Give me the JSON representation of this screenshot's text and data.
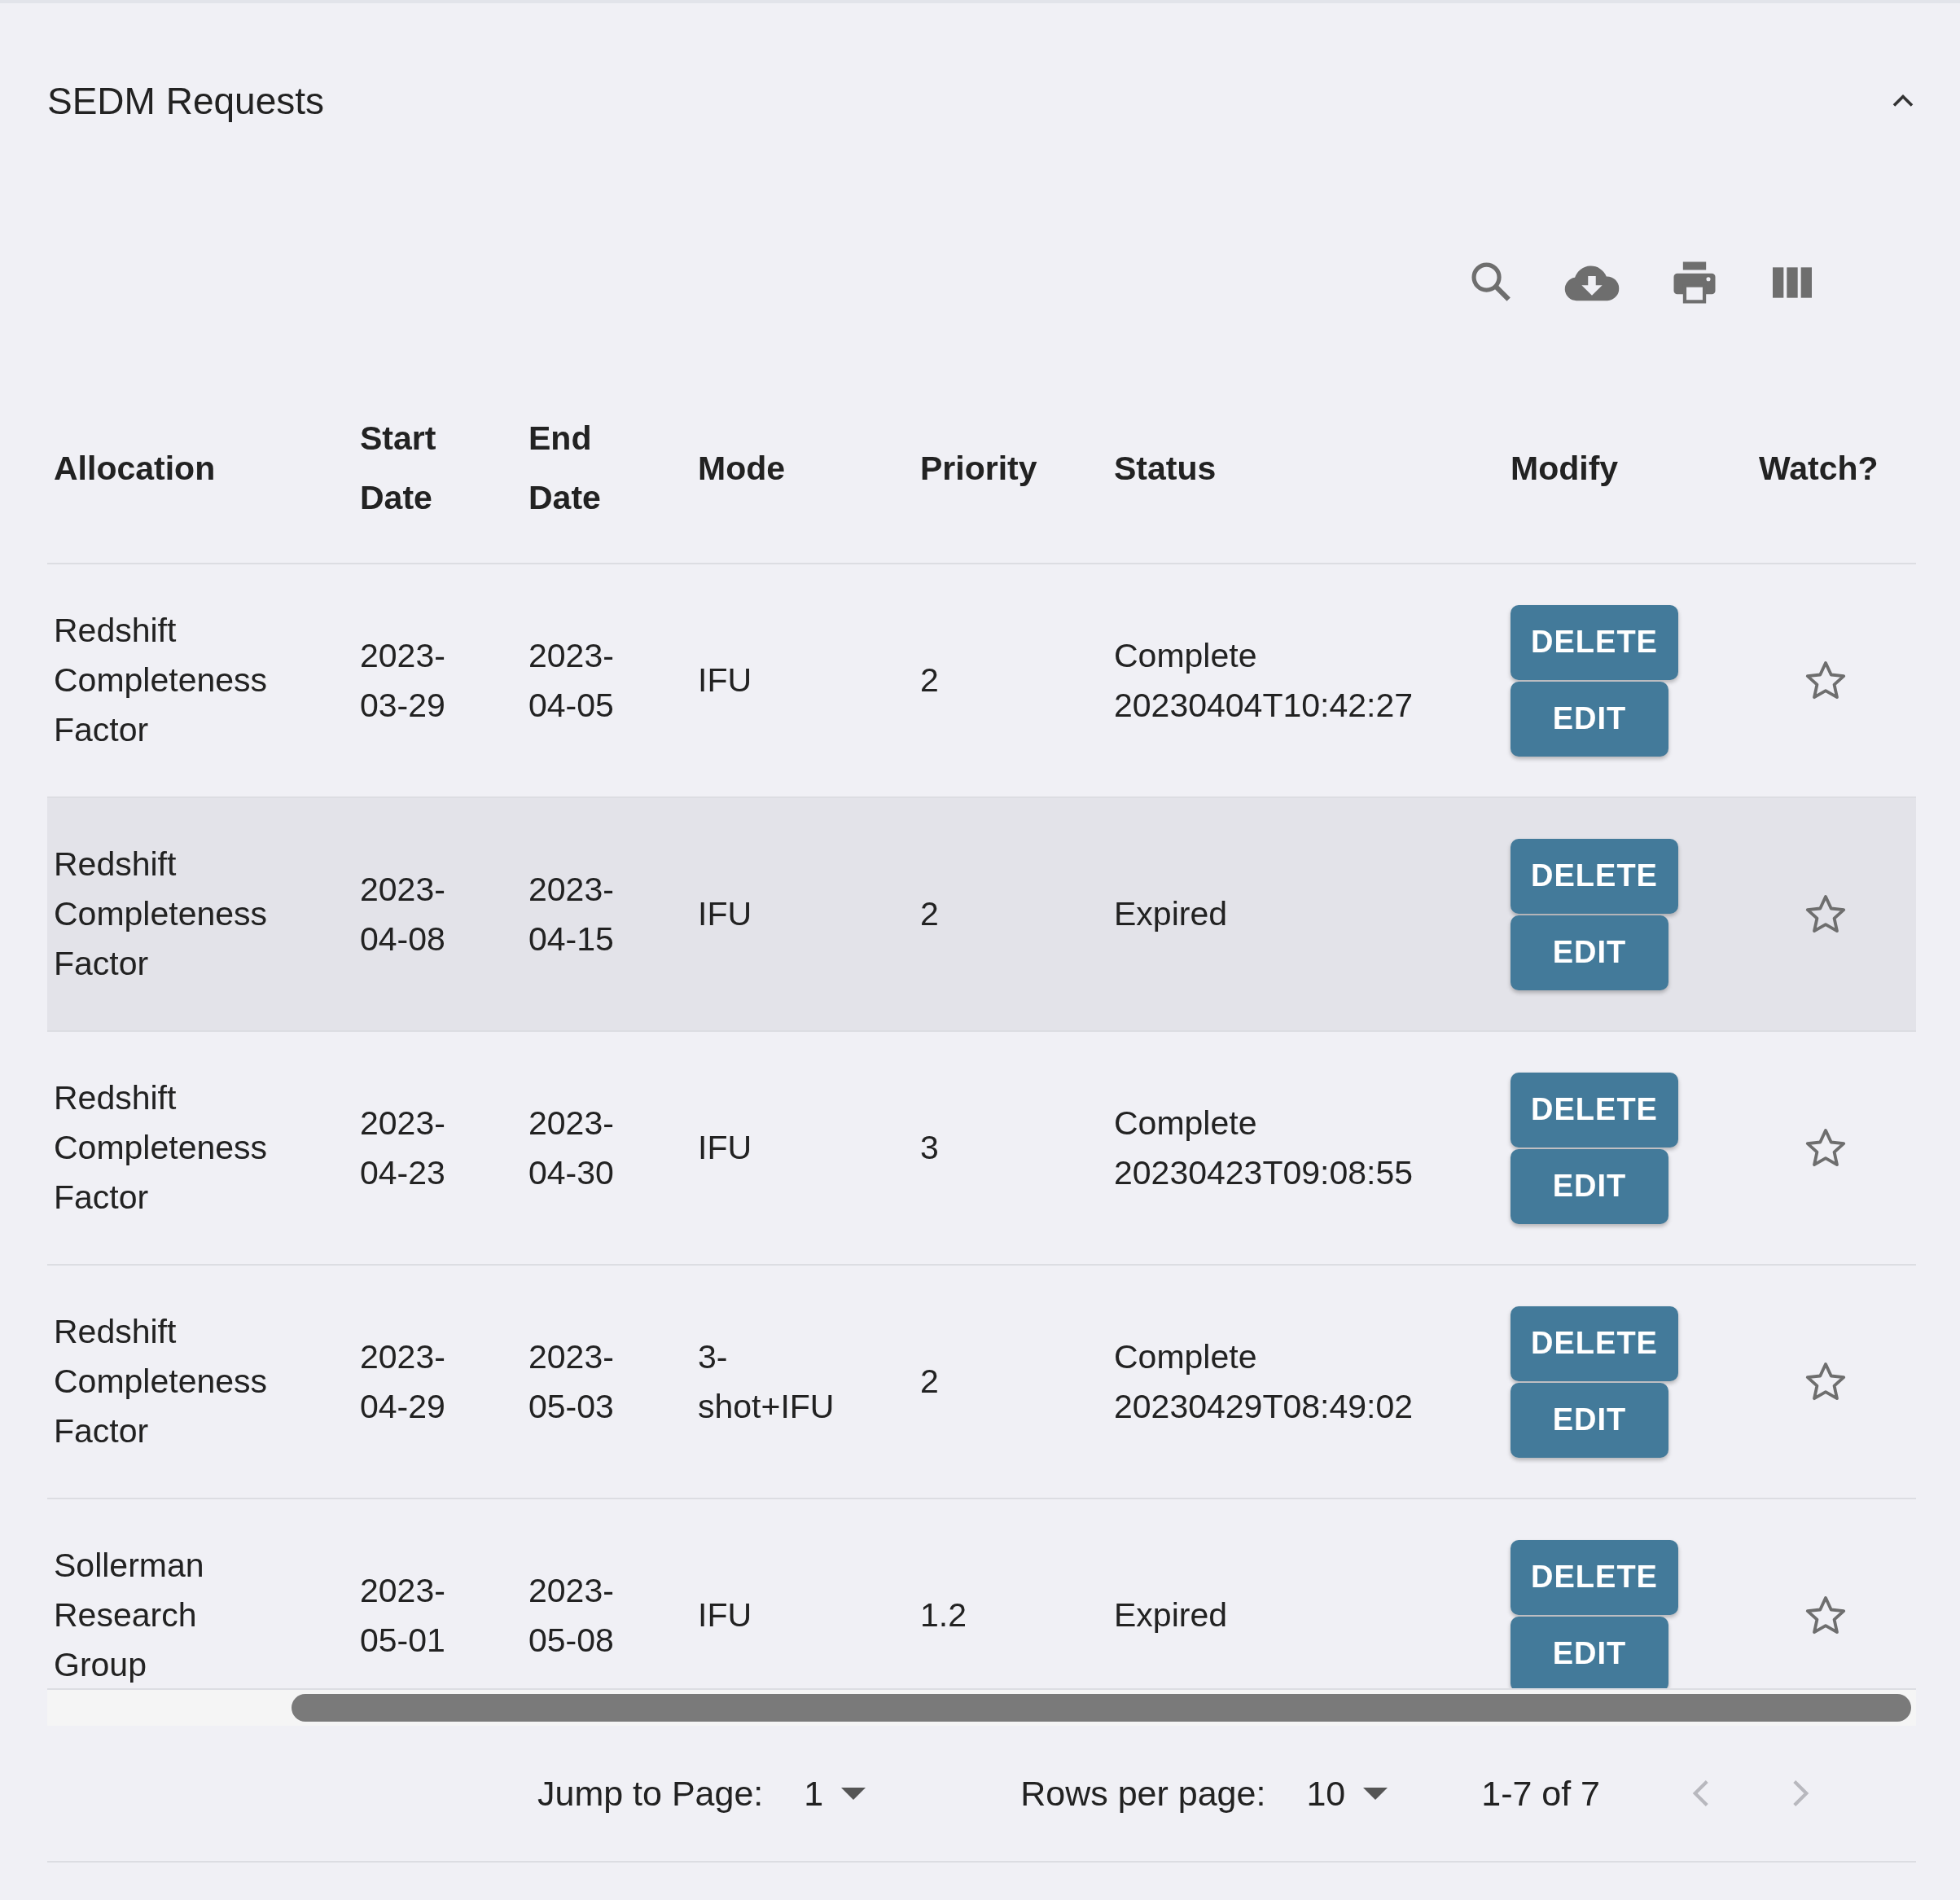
{
  "panel": {
    "title": "SEDM Requests",
    "expanded": true
  },
  "table": {
    "columns": [
      "Allocation",
      "Start Date",
      "End Date",
      "Mode",
      "Priority",
      "Status",
      "Modify",
      "Watch?"
    ],
    "rows": [
      {
        "allocation": "Redshift Completeness Factor",
        "start_date": "2023-03-29",
        "end_date": "2023-04-05",
        "mode": "IFU",
        "priority": "2",
        "status": "Complete 20230404T10:42:27",
        "buttons": [
          "DELETE",
          "EDIT"
        ],
        "watched": false,
        "highlighted": false
      },
      {
        "allocation": "Redshift Completeness Factor",
        "start_date": "2023-04-08",
        "end_date": "2023-04-15",
        "mode": "IFU",
        "priority": "2",
        "status": "Expired",
        "buttons": [
          "DELETE",
          "EDIT"
        ],
        "watched": false,
        "highlighted": true
      },
      {
        "allocation": "Redshift Completeness Factor",
        "start_date": "2023-04-23",
        "end_date": "2023-04-30",
        "mode": "IFU",
        "priority": "3",
        "status": "Complete 20230423T09:08:55",
        "buttons": [
          "DELETE",
          "EDIT"
        ],
        "watched": false,
        "highlighted": false
      },
      {
        "allocation": "Redshift Completeness Factor",
        "start_date": "2023-04-29",
        "end_date": "2023-05-03",
        "mode": "3-shot+IFU",
        "priority": "2",
        "status": "Complete 20230429T08:49:02",
        "buttons": [
          "DELETE",
          "EDIT"
        ],
        "watched": false,
        "highlighted": false
      },
      {
        "allocation": "Sollerman Research Group",
        "start_date": "2023-05-01",
        "end_date": "2023-05-08",
        "mode": "IFU",
        "priority": "1.2",
        "status": "Expired",
        "buttons": [
          "DELETE",
          "EDIT"
        ],
        "watched": false,
        "highlighted": false
      }
    ]
  },
  "pagination": {
    "jump_label": "Jump to Page:",
    "page": "1",
    "rows_label": "Rows per page:",
    "rows_per_page": "10",
    "range": "1-7 of 7"
  }
}
